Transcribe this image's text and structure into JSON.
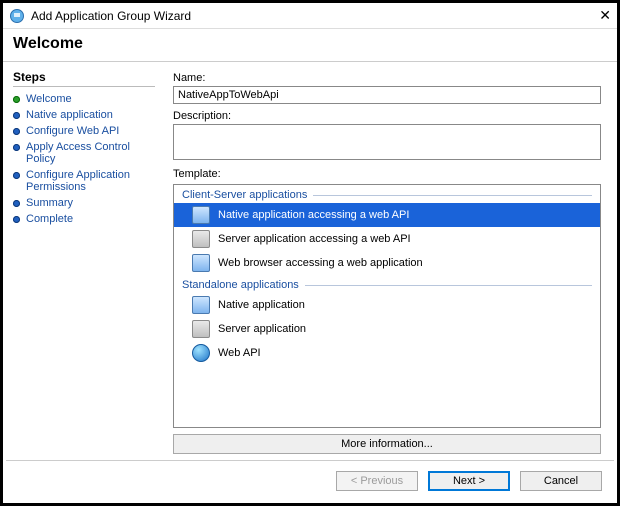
{
  "window": {
    "title": "Add Application Group Wizard",
    "close": "✕"
  },
  "header": "Welcome",
  "steps_header": "Steps",
  "steps": [
    {
      "label": "Welcome",
      "current": true
    },
    {
      "label": "Native application",
      "current": false
    },
    {
      "label": "Configure Web API",
      "current": false
    },
    {
      "label": "Apply Access Control Policy",
      "current": false
    },
    {
      "label": "Configure Application Permissions",
      "current": false
    },
    {
      "label": "Summary",
      "current": false
    },
    {
      "label": "Complete",
      "current": false
    }
  ],
  "labels": {
    "name": "Name:",
    "description": "Description:",
    "template": "Template:",
    "more_info": "More information..."
  },
  "fields": {
    "name_value": "NativeAppToWebApi",
    "description_value": ""
  },
  "templates": {
    "group1": "Client-Server applications",
    "group2": "Standalone applications",
    "items_g1": [
      {
        "label": "Native application accessing a web API",
        "icon": "monitor-icon",
        "selected": true
      },
      {
        "label": "Server application accessing a web API",
        "icon": "server-icon",
        "selected": false
      },
      {
        "label": "Web browser accessing a web application",
        "icon": "monitor-icon",
        "selected": false
      }
    ],
    "items_g2": [
      {
        "label": "Native application",
        "icon": "monitor-icon",
        "selected": false
      },
      {
        "label": "Server application",
        "icon": "server-icon",
        "selected": false
      },
      {
        "label": "Web API",
        "icon": "globe-icon",
        "selected": false
      }
    ]
  },
  "buttons": {
    "previous": "< Previous",
    "next": "Next >",
    "cancel": "Cancel"
  }
}
